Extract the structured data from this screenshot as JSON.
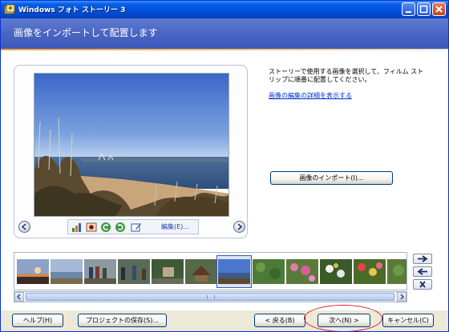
{
  "window": {
    "title": "Windows フォト ストーリー 3"
  },
  "header": {
    "title": "画像をインポートして配置します"
  },
  "instructions": {
    "text": "ストーリーで使用する画像を選択して、フィルム ストリップに順番に配置してください。",
    "link": "画像の編集の詳細を表示する"
  },
  "preview": {
    "edit_label": "編集(E)..."
  },
  "import_button": "画像のインポート(I)...",
  "filmstrip": {
    "thumbnails": [
      "sunset",
      "seascape",
      "people",
      "people-2",
      "shrine",
      "temple",
      "dune",
      "selected-seascape",
      "greenery",
      "pink-flowers",
      "flowers",
      "red-flowers"
    ],
    "selected_index": 7
  },
  "footer": {
    "help": "ヘルプ(H)",
    "save_project": "プロジェクトの保存(S)...",
    "back": "< 戻る(B)",
    "next": "次へ(N) >",
    "cancel": "キャンセル(C)"
  },
  "icons": {
    "app": "photo-story-icon",
    "minimize": "minimize-icon",
    "maximize": "maximize-icon",
    "close": "close-icon",
    "prev": "arrow-left-circle-icon",
    "next": "arrow-right-circle-icon",
    "levels": "auto-levels-icon",
    "redeye": "red-eye-icon",
    "rotate_left": "rotate-left-icon",
    "rotate_right": "rotate-right-icon",
    "edit": "edit-icon",
    "move_right": "move-right-icon",
    "move_left": "move-left-icon",
    "remove": "remove-icon"
  },
  "colors": {
    "title_bar": "#0250d6",
    "header": "#4a66c4",
    "accent": "#f2a33a",
    "link": "#0033cc",
    "highlight": "#e0202a"
  }
}
